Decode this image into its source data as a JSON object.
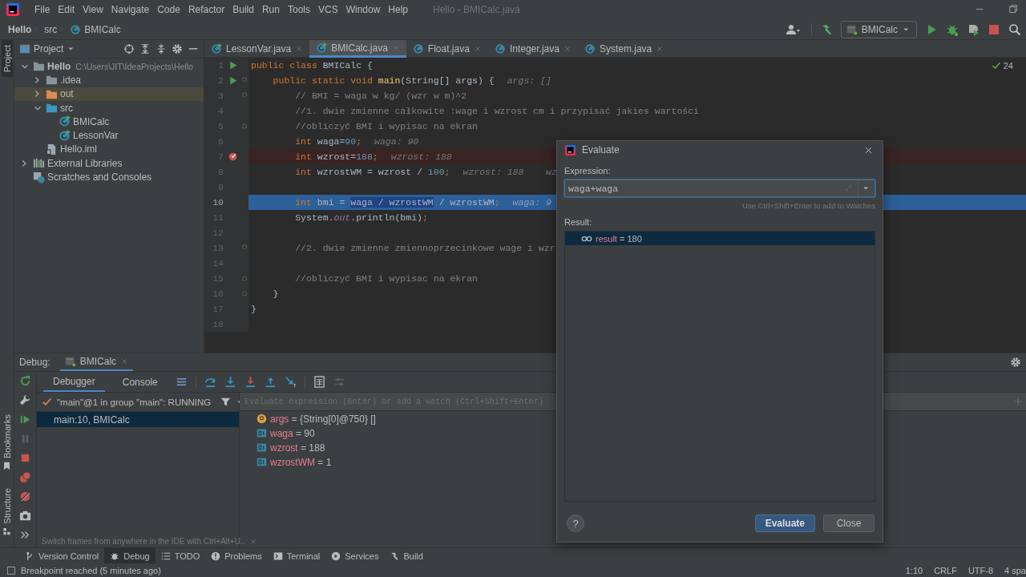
{
  "window": {
    "title": "Hello - BMICalc.java"
  },
  "menu": [
    "File",
    "Edit",
    "View",
    "Navigate",
    "Code",
    "Refactor",
    "Build",
    "Run",
    "Tools",
    "VCS",
    "Window",
    "Help"
  ],
  "breadcrumbs": [
    {
      "label": "Hello",
      "kind": "project"
    },
    {
      "label": "src",
      "kind": "folder"
    },
    {
      "label": "BMICalc",
      "kind": "class"
    }
  ],
  "run_config": "BMICalc",
  "side_tabs": {
    "top": [
      {
        "label": "Project",
        "selected": true
      }
    ],
    "bottom": [
      {
        "label": "Bookmarks",
        "selected": false
      },
      {
        "label": "Structure",
        "selected": false
      }
    ]
  },
  "project_panel": {
    "title": "Project",
    "tree": [
      {
        "label": "Hello",
        "kind": "module",
        "path": "C:\\Users\\JIT\\IdeaProjects\\Hello",
        "expanded": true,
        "selected": false,
        "children": [
          {
            "label": ".idea",
            "kind": "folder",
            "expanded": false,
            "selected": false
          },
          {
            "label": "out",
            "kind": "excluded-folder",
            "expanded": false,
            "selected": true
          },
          {
            "label": "src",
            "kind": "source-folder",
            "expanded": true,
            "selected": false,
            "children": [
              {
                "label": "BMICalc",
                "kind": "runnable-class",
                "selected": false
              },
              {
                "label": "LessonVar",
                "kind": "runnable-class",
                "selected": false
              }
            ]
          },
          {
            "label": "Hello.iml",
            "kind": "file",
            "selected": false
          }
        ]
      },
      {
        "label": "External Libraries",
        "kind": "libraries",
        "expanded": false,
        "selected": false
      },
      {
        "label": "Scratches and Consoles",
        "kind": "scratches",
        "selected": false
      }
    ]
  },
  "editor_tabs": [
    {
      "label": "LessonVar.java",
      "kind": "runnable-class",
      "selected": false
    },
    {
      "label": "BMICalc.java",
      "kind": "runnable-class",
      "selected": true
    },
    {
      "label": "Float.java",
      "kind": "class",
      "selected": false
    },
    {
      "label": "Integer.java",
      "kind": "class",
      "selected": false
    },
    {
      "label": "System.java",
      "kind": "class",
      "selected": false
    }
  ],
  "editor": {
    "problems_count": "24",
    "lines": [
      {
        "number": "1",
        "run_icon": true,
        "breakpoint": false,
        "executing": false,
        "fold_start": false,
        "fold_end": false,
        "segments": [
          {
            "kind": "keyword",
            "text": "public class "
          },
          {
            "kind": "plain",
            "text": "BMICalc {"
          }
        ]
      },
      {
        "number": "2",
        "run_icon": true,
        "breakpoint": false,
        "executing": false,
        "fold_start": true,
        "fold_end": false,
        "segments": [
          {
            "kind": "keyword",
            "text": "    public static void "
          },
          {
            "kind": "method",
            "text": "main"
          },
          {
            "kind": "plain",
            "text": "(String[] args) {"
          }
        ],
        "hint": "args: []"
      },
      {
        "number": "3",
        "run_icon": false,
        "breakpoint": false,
        "executing": false,
        "fold_start": true,
        "fold_end": false,
        "segments": [
          {
            "kind": "comment",
            "text": "        // BMI = waga w kg/ (wzr w m)^2"
          }
        ]
      },
      {
        "number": "4",
        "run_icon": false,
        "breakpoint": false,
        "executing": false,
        "fold_start": false,
        "fold_end": false,
        "segments": [
          {
            "kind": "comment",
            "text": "        //1. dwie zmienne całkowite :wage i wzrost cm i przypisać jakies wartości"
          }
        ]
      },
      {
        "number": "5",
        "run_icon": false,
        "breakpoint": false,
        "executing": false,
        "fold_start": false,
        "fold_end": true,
        "segments": [
          {
            "kind": "comment",
            "text": "        //obliczyć BMI i wypisac na ekran"
          }
        ]
      },
      {
        "number": "6",
        "run_icon": false,
        "breakpoint": false,
        "executing": false,
        "fold_start": false,
        "fold_end": false,
        "segments": [
          {
            "kind": "keyword",
            "text": "        int "
          },
          {
            "kind": "plain",
            "text": "waga="
          },
          {
            "kind": "number",
            "text": "90"
          },
          {
            "kind": "keyword",
            "text": ";"
          }
        ],
        "hint": "waga: 90"
      },
      {
        "number": "7",
        "run_icon": false,
        "breakpoint": true,
        "executing": false,
        "fold_start": false,
        "fold_end": false,
        "segments": [
          {
            "kind": "keyword",
            "text": "        int "
          },
          {
            "kind": "plain",
            "text": "wzrost="
          },
          {
            "kind": "number",
            "text": "188"
          },
          {
            "kind": "keyword",
            "text": ";"
          }
        ],
        "hint": "wzrost: 188"
      },
      {
        "number": "8",
        "run_icon": false,
        "breakpoint": false,
        "executing": false,
        "fold_start": false,
        "fold_end": false,
        "segments": [
          {
            "kind": "keyword",
            "text": "        int "
          },
          {
            "kind": "plain",
            "text": "wzrostWM = wzrost / "
          },
          {
            "kind": "number",
            "text": "100"
          },
          {
            "kind": "keyword",
            "text": ";"
          }
        ],
        "hint": "wzrost: 188    wz"
      },
      {
        "number": "9",
        "run_icon": false,
        "breakpoint": false,
        "executing": false,
        "fold_start": false,
        "fold_end": false
      },
      {
        "number": "10",
        "run_icon": false,
        "breakpoint": false,
        "executing": true,
        "fold_start": false,
        "fold_end": false,
        "segments": [
          {
            "kind": "keyword",
            "text": "        int "
          },
          {
            "kind": "plain",
            "text": "bmi = "
          },
          {
            "kind": "selection",
            "text": "waga / wzrostWM"
          },
          {
            "kind": "plain",
            "text": " / wzrostWM"
          },
          {
            "kind": "keyword",
            "text": ";"
          }
        ],
        "hint": "waga: 9"
      },
      {
        "number": "11",
        "run_icon": false,
        "breakpoint": false,
        "executing": false,
        "fold_start": false,
        "fold_end": false,
        "segments": [
          {
            "kind": "plain",
            "text": "        System."
          },
          {
            "kind": "field",
            "text": "out"
          },
          {
            "kind": "plain",
            "text": ".println(bmi)"
          },
          {
            "kind": "keyword",
            "text": ";"
          }
        ]
      },
      {
        "number": "12",
        "run_icon": false,
        "breakpoint": false,
        "executing": false,
        "fold_start": false,
        "fold_end": false
      },
      {
        "number": "13",
        "run_icon": false,
        "breakpoint": false,
        "executing": false,
        "fold_start": true,
        "fold_end": false,
        "segments": [
          {
            "kind": "comment",
            "text": "        //2. dwie zmienne zmiennoprzecinkowe wage i wzr"
          }
        ]
      },
      {
        "number": "14",
        "run_icon": false,
        "breakpoint": false,
        "executing": false,
        "fold_start": false,
        "fold_end": false
      },
      {
        "number": "15",
        "run_icon": false,
        "breakpoint": false,
        "executing": false,
        "fold_start": false,
        "fold_end": true,
        "segments": [
          {
            "kind": "comment",
            "text": "        //obliczyć BMI i wypisac na ekran"
          }
        ]
      },
      {
        "number": "16",
        "run_icon": false,
        "breakpoint": false,
        "executing": false,
        "fold_start": false,
        "fold_end": true,
        "segments": [
          {
            "kind": "plain",
            "text": "    }"
          }
        ]
      },
      {
        "number": "17",
        "run_icon": false,
        "breakpoint": false,
        "executing": false,
        "fold_start": false,
        "fold_end": false,
        "segments": [
          {
            "kind": "plain",
            "text": "}"
          }
        ]
      },
      {
        "number": "18",
        "run_icon": false,
        "breakpoint": false,
        "executing": false,
        "fold_start": false,
        "fold_end": false
      }
    ]
  },
  "debug": {
    "title": "Debug:",
    "session_tab": "BMICalc",
    "tabs": [
      {
        "label": "Debugger",
        "selected": true
      },
      {
        "label": "Console",
        "selected": false
      }
    ],
    "thread": "\"main\"@1 in group \"main\": RUNNING",
    "frames": [
      {
        "label": "main:10, BMICalc",
        "selected": true
      }
    ],
    "frames_hint": "Switch frames from anywhere in the IDE with Ctrl+Alt+U..",
    "watch_placeholder": "Evaluate expression (Enter) or add a watch (Ctrl+Shift+Enter)",
    "variables": [
      {
        "kind": "parameter",
        "name": "args",
        "value": "= {String[0]@750} []"
      },
      {
        "kind": "primitive",
        "name": "waga",
        "value": "= 90"
      },
      {
        "kind": "primitive",
        "name": "wzrost",
        "value": "= 188"
      },
      {
        "kind": "primitive",
        "name": "wzrostWM",
        "value": "= 1"
      }
    ]
  },
  "evaluate_dialog": {
    "title": "Evaluate",
    "expression_label": "Expression:",
    "expression": "waga+waga",
    "hint": "Use Ctrl+Shift+Enter to add to Watches",
    "result_label": "Result:",
    "results": [
      {
        "name": "result",
        "value": "= 180",
        "selected": true
      }
    ],
    "help_label": "?",
    "buttons": [
      {
        "label": "Evaluate",
        "default": true
      },
      {
        "label": "Close",
        "default": false
      }
    ]
  },
  "tool_windows": [
    {
      "label": "Version Control",
      "kind": "vcs",
      "selected": false
    },
    {
      "label": "Debug",
      "kind": "debug",
      "selected": true
    },
    {
      "label": "TODO",
      "kind": "todo",
      "selected": false
    },
    {
      "label": "Problems",
      "kind": "problems",
      "selected": false
    },
    {
      "label": "Terminal",
      "kind": "terminal",
      "selected": false
    },
    {
      "label": "Services",
      "kind": "services",
      "selected": false
    },
    {
      "label": "Build",
      "kind": "build",
      "selected": false
    }
  ],
  "status_bar": {
    "message": "Breakpoint reached (5 minutes ago)",
    "position": "1:10",
    "line_separator": "CRLF",
    "encoding": "UTF-8",
    "indent": "4 spa"
  }
}
